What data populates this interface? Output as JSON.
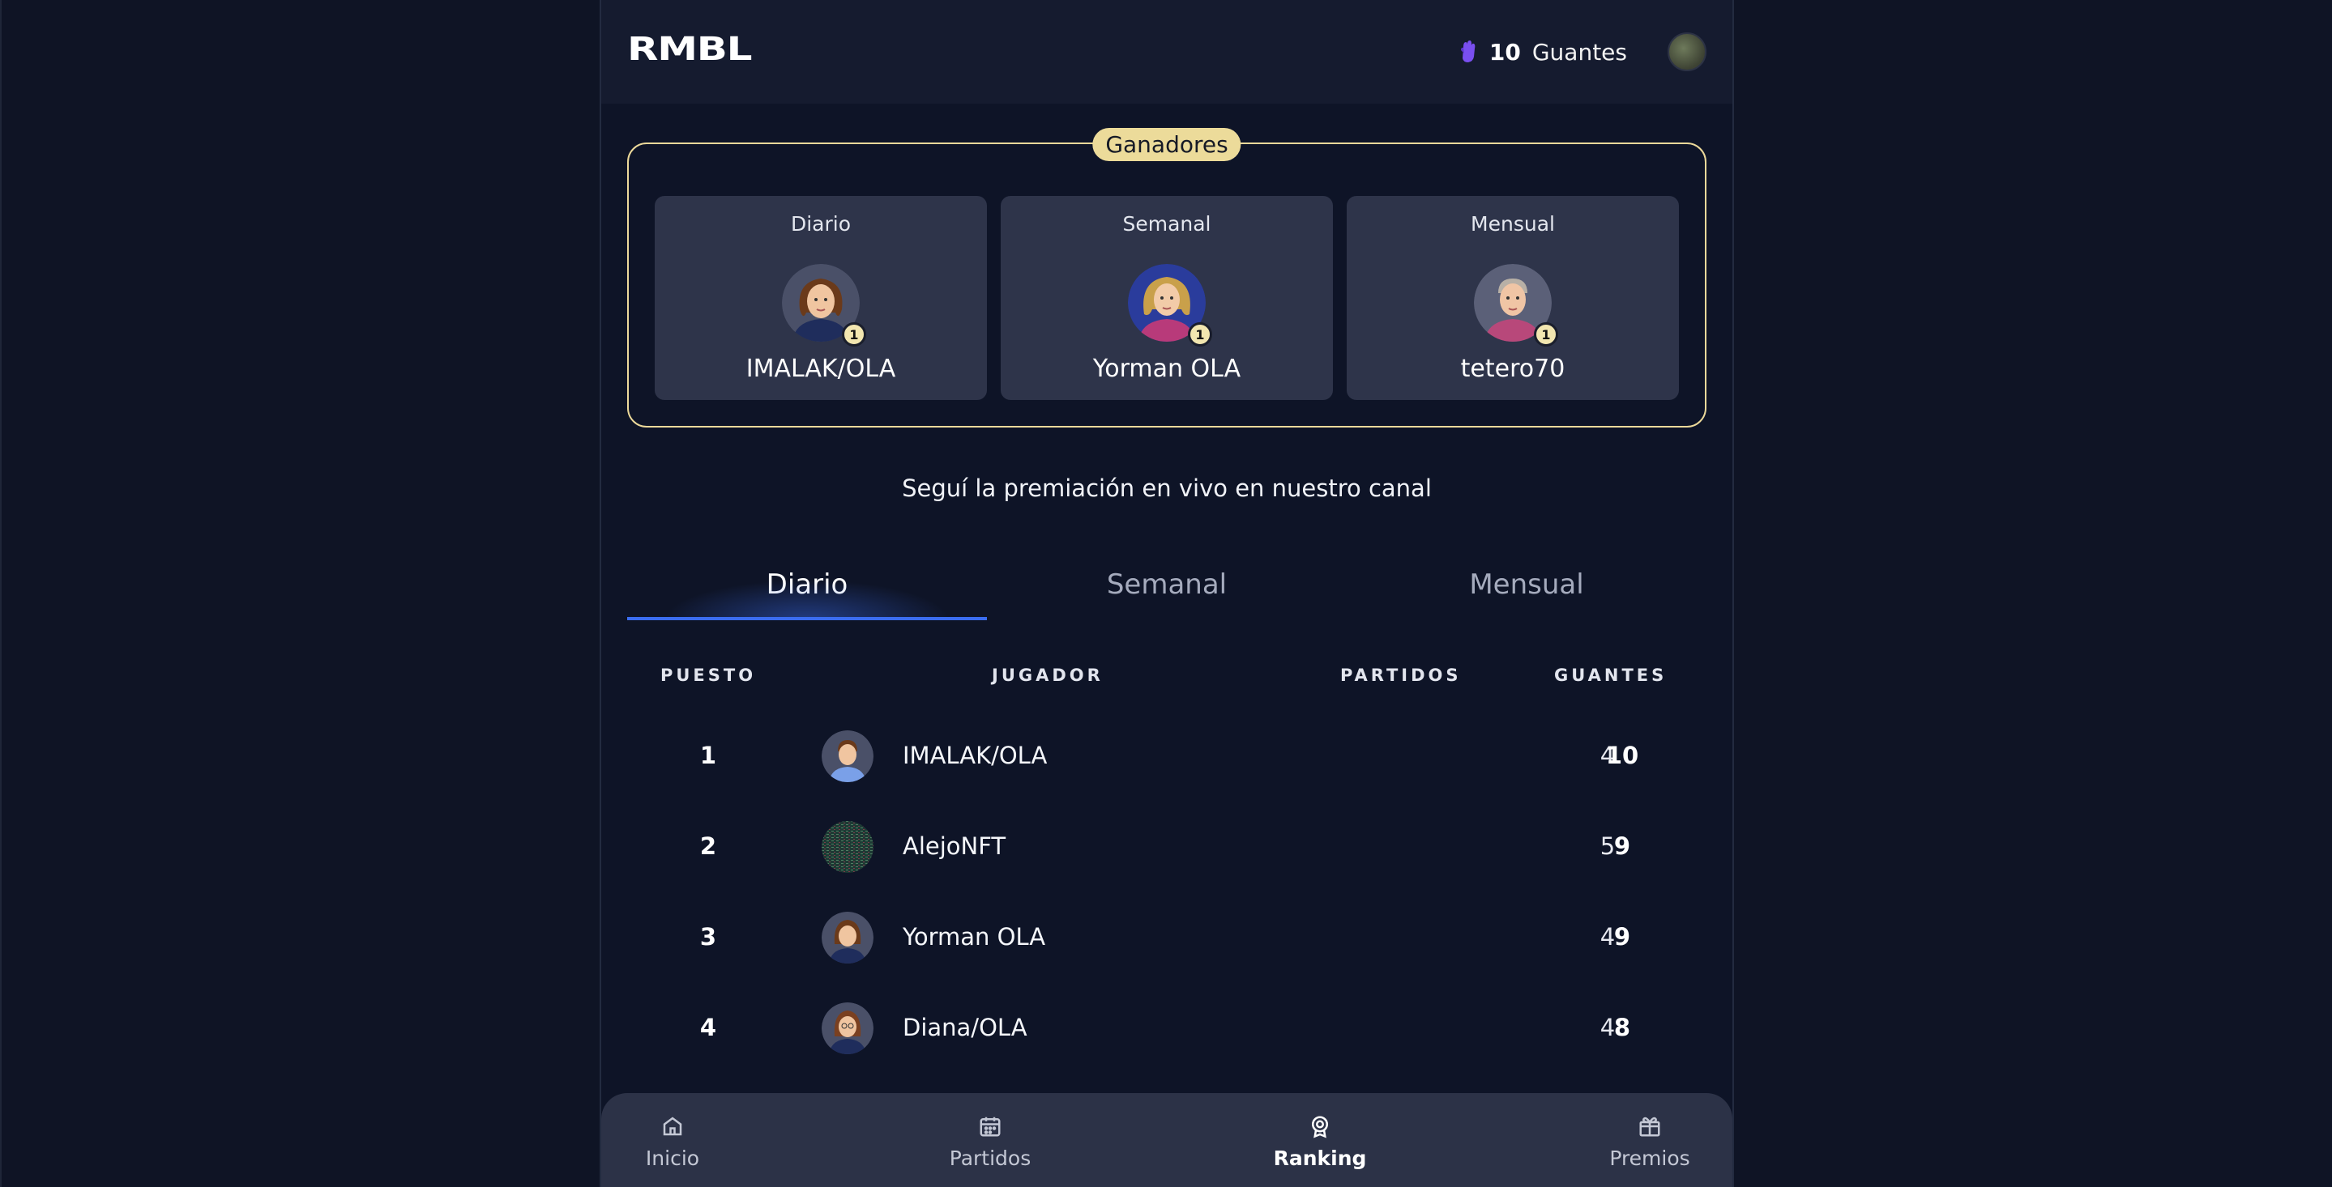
{
  "header": {
    "logo": "RMBL",
    "gloves_count": "10",
    "gloves_label": "Guantes"
  },
  "winners": {
    "badge": "Ganadores",
    "cards": [
      {
        "period": "Diario",
        "name": "IMALAK/OLA",
        "rank": "1"
      },
      {
        "period": "Semanal",
        "name": "Yorman OLA",
        "rank": "1"
      },
      {
        "period": "Mensual",
        "name": "tetero70",
        "rank": "1"
      }
    ]
  },
  "announcement": "Seguí la premiación en vivo en nuestro canal",
  "tabs": [
    {
      "label": "Diario",
      "active": true
    },
    {
      "label": "Semanal",
      "active": false
    },
    {
      "label": "Mensual",
      "active": false
    }
  ],
  "table": {
    "headers": {
      "position": "PUESTO",
      "player": "JUGADOR",
      "matches": "PARTIDOS",
      "gloves": "GUANTES"
    },
    "rows": [
      {
        "position": "1",
        "player": "IMALAK/OLA",
        "matches": "4",
        "gloves": "10"
      },
      {
        "position": "2",
        "player": "AlejoNFT",
        "matches": "5",
        "gloves": "9"
      },
      {
        "position": "3",
        "player": "Yorman OLA",
        "matches": "4",
        "gloves": "9"
      },
      {
        "position": "4",
        "player": "Diana/OLA",
        "matches": "4",
        "gloves": "8"
      }
    ]
  },
  "bottom_nav": [
    {
      "label": "Inicio",
      "icon": "home-icon",
      "active": false
    },
    {
      "label": "Partidos",
      "icon": "calendar-icon",
      "active": false
    },
    {
      "label": "Ranking",
      "icon": "award-icon",
      "active": true
    },
    {
      "label": "Premios",
      "icon": "gift-icon",
      "active": false
    }
  ],
  "colors": {
    "background": "#0e1427",
    "accent": "#3b6df0",
    "gold": "#ecd99a"
  }
}
